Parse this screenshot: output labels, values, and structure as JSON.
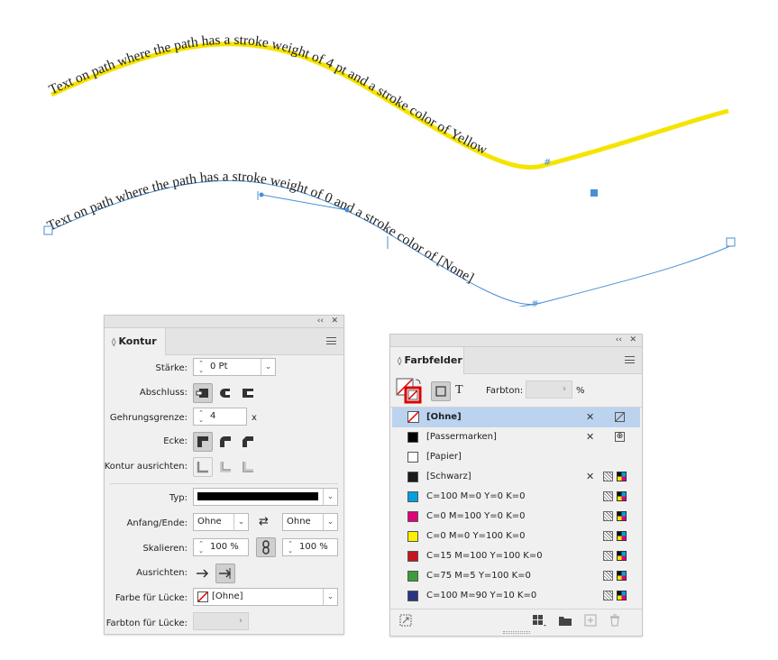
{
  "canvas": {
    "path1_text": "Text on path where the path has a stroke weight of 4 pt and a stroke color of Yellow",
    "path2_text": "Text on path where the path has a stroke weight of 0 and a stroke color of [None]",
    "path1_stroke_color": "#f5e400",
    "selection_color": "#4a8fd6"
  },
  "kontur": {
    "title": "Kontur",
    "collapse": "‹‹",
    "close": "✕",
    "staerke_label": "Stärke:",
    "staerke_value": "0 Pt",
    "abschluss_label": "Abschluss:",
    "gehrung_label": "Gehrungsgrenze:",
    "gehrung_value": "4",
    "gehrung_unit": "x",
    "ecke_label": "Ecke:",
    "ausrichten_label": "Kontur ausrichten:",
    "typ_label": "Typ:",
    "anfang_label": "Anfang/Ende:",
    "anfang_value": "Ohne",
    "ende_value": "Ohne",
    "skalieren_label": "Skalieren:",
    "skalieren_start": "100 %",
    "skalieren_end": "100 %",
    "ausrichten2_label": "Ausrichten:",
    "farbe_luecke_label": "Farbe für Lücke:",
    "farbe_luecke_value": "[Ohne]",
    "farbton_luecke_label": "Farbton für Lücke:"
  },
  "farbfelder": {
    "title": "Farbfelder",
    "collapse": "‹‹",
    "close": "✕",
    "text_toggle": "T",
    "farbton_label": "Farbton:",
    "farbton_unit": "%",
    "swatches": [
      {
        "name": "[Ohne]",
        "color": "none",
        "selected": true
      },
      {
        "name": "[Passermarken]",
        "color": "#000000"
      },
      {
        "name": "[Papier]",
        "color": "#ffffff"
      },
      {
        "name": "[Schwarz]",
        "color": "#1a1a1a"
      },
      {
        "name": "C=100 M=0 Y=0 K=0",
        "color": "#00a0e0"
      },
      {
        "name": "C=0 M=100 Y=0 K=0",
        "color": "#e0007a"
      },
      {
        "name": "C=0 M=0 Y=100 K=0",
        "color": "#fff000"
      },
      {
        "name": "C=15 M=100 Y=100 K=0",
        "color": "#c8161e"
      },
      {
        "name": "C=75 M=5 Y=100 K=0",
        "color": "#3d9d3a"
      },
      {
        "name": "C=100 M=90 Y=10 K=0",
        "color": "#2a3580"
      }
    ]
  }
}
